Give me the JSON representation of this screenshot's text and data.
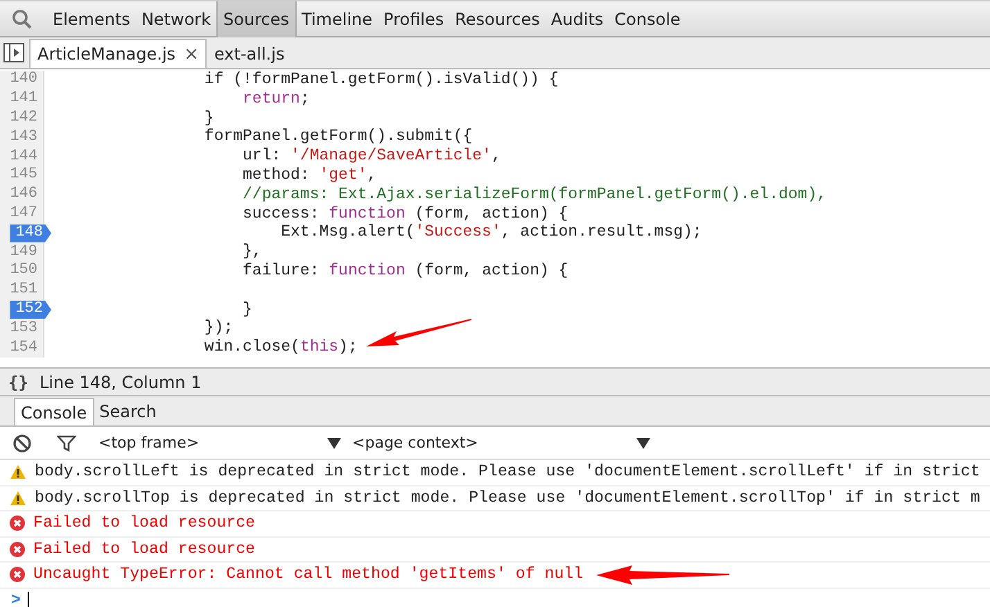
{
  "panel_tabs": [
    {
      "label": "Elements",
      "selected": false
    },
    {
      "label": "Network",
      "selected": false
    },
    {
      "label": "Sources",
      "selected": true
    },
    {
      "label": "Timeline",
      "selected": false
    },
    {
      "label": "Profiles",
      "selected": false
    },
    {
      "label": "Resources",
      "selected": false
    },
    {
      "label": "Audits",
      "selected": false
    },
    {
      "label": "Console",
      "selected": false
    }
  ],
  "file_tabs": [
    {
      "label": "ArticleManage.js",
      "selected": true,
      "close": "×"
    },
    {
      "label": "ext-all.js",
      "selected": false
    }
  ],
  "code": [
    {
      "number": "140",
      "breakpoint": false,
      "tokens": [
        {
          "kind": "plain",
          "text": "                if (!formPanel.getForm().isValid()) {"
        }
      ]
    },
    {
      "number": "141",
      "breakpoint": false,
      "tokens": [
        {
          "kind": "keyword",
          "text": "                    return"
        },
        {
          "kind": "plain",
          "text": ";"
        }
      ]
    },
    {
      "number": "142",
      "breakpoint": false,
      "tokens": [
        {
          "kind": "plain",
          "text": "                }"
        }
      ]
    },
    {
      "number": "143",
      "breakpoint": false,
      "tokens": [
        {
          "kind": "plain",
          "text": "                formPanel.getForm().submit({"
        }
      ]
    },
    {
      "number": "144",
      "breakpoint": false,
      "tokens": [
        {
          "kind": "plain",
          "text": "                    url: "
        },
        {
          "kind": "string",
          "text": "'/Manage/SaveArticle'"
        },
        {
          "kind": "plain",
          "text": ","
        }
      ]
    },
    {
      "number": "145",
      "breakpoint": false,
      "tokens": [
        {
          "kind": "plain",
          "text": "                    method: "
        },
        {
          "kind": "string",
          "text": "'get'"
        },
        {
          "kind": "plain",
          "text": ","
        }
      ]
    },
    {
      "number": "146",
      "breakpoint": false,
      "tokens": [
        {
          "kind": "comment",
          "text": "                    //params: Ext.Ajax.serializeForm(formPanel.getForm().el.dom),"
        }
      ]
    },
    {
      "number": "147",
      "breakpoint": false,
      "tokens": [
        {
          "kind": "plain",
          "text": "                    success: "
        },
        {
          "kind": "keyword",
          "text": "function"
        },
        {
          "kind": "plain",
          "text": " (form, action) {"
        }
      ]
    },
    {
      "number": "148",
      "breakpoint": true,
      "tokens": [
        {
          "kind": "plain",
          "text": "                        Ext.Msg.alert("
        },
        {
          "kind": "string",
          "text": "'Success'"
        },
        {
          "kind": "plain",
          "text": ", action.result.msg);"
        }
      ]
    },
    {
      "number": "149",
      "breakpoint": false,
      "tokens": [
        {
          "kind": "plain",
          "text": "                    },"
        }
      ]
    },
    {
      "number": "150",
      "breakpoint": false,
      "tokens": [
        {
          "kind": "plain",
          "text": "                    failure: "
        },
        {
          "kind": "keyword",
          "text": "function"
        },
        {
          "kind": "plain",
          "text": " (form, action) {"
        }
      ]
    },
    {
      "number": "151",
      "breakpoint": false
    },
    {
      "number": "152",
      "breakpoint": true,
      "tokens": [
        {
          "kind": "plain",
          "text": "                    }"
        }
      ]
    },
    {
      "number": "153",
      "breakpoint": false,
      "tokens": [
        {
          "kind": "plain",
          "text": "                });"
        }
      ]
    },
    {
      "number": "154",
      "breakpoint": false,
      "tokens": [
        {
          "kind": "plain",
          "text": "                win.close("
        },
        {
          "kind": "keyword",
          "text": "this"
        },
        {
          "kind": "plain",
          "text": ");"
        }
      ]
    }
  ],
  "status_bar": {
    "pretty_print": "{}",
    "position": "Line 148, Column 1"
  },
  "drawer_tabs": [
    {
      "label": "Console",
      "selected": true
    },
    {
      "label": "Search",
      "selected": false
    }
  ],
  "console_toolbar": {
    "frame": "<top frame>",
    "context": "<page context>"
  },
  "messages": [
    {
      "kind": "warning",
      "text": "body.scrollLeft is deprecated in strict mode. Please use 'documentElement.scrollLeft' if in strict"
    },
    {
      "kind": "warning",
      "text": "body.scrollTop is deprecated in strict mode. Please use 'documentElement.scrollTop' if in strict m"
    },
    {
      "kind": "error",
      "text": "Failed to load resource"
    },
    {
      "kind": "error",
      "text": "Failed to load resource"
    },
    {
      "kind": "error",
      "text": "Uncaught TypeError: Cannot call method 'getItems' of null"
    }
  ],
  "prompt": ">"
}
